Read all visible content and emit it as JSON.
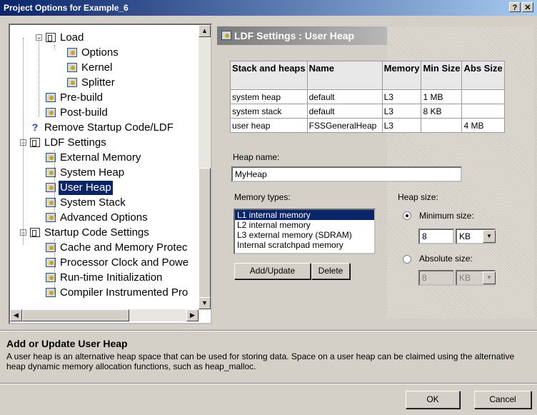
{
  "window": {
    "title": "Project Options for Example_6",
    "help_glyph": "?",
    "close_glyph": "✕"
  },
  "tree": {
    "items": [
      {
        "label": "Load",
        "icon": "folder-icon",
        "expander": "−"
      },
      {
        "label": "Options",
        "icon": "settings-icon"
      },
      {
        "label": "Kernel",
        "icon": "settings-icon"
      },
      {
        "label": "Splitter",
        "icon": "settings-icon"
      },
      {
        "label": "Pre-build",
        "icon": "settings-icon"
      },
      {
        "label": "Post-build",
        "icon": "settings-icon"
      },
      {
        "label": "Remove Startup Code/LDF",
        "icon": "question-icon"
      },
      {
        "label": "LDF Settings",
        "icon": "folder-icon",
        "expander": "−"
      },
      {
        "label": "External Memory",
        "icon": "settings-icon"
      },
      {
        "label": "System Heap",
        "icon": "settings-icon"
      },
      {
        "label": "User Heap",
        "icon": "settings-icon",
        "selected": true
      },
      {
        "label": "System Stack",
        "icon": "settings-icon"
      },
      {
        "label": "Advanced Options",
        "icon": "settings-icon"
      },
      {
        "label": "Startup Code Settings",
        "icon": "folder-icon",
        "expander": "−"
      },
      {
        "label": "Cache and Memory Protec",
        "icon": "settings-icon"
      },
      {
        "label": "Processor Clock and Powe",
        "icon": "settings-icon"
      },
      {
        "label": "Run-time Initialization",
        "icon": "settings-icon"
      },
      {
        "label": "Compiler Instrumented Pro",
        "icon": "settings-icon"
      }
    ],
    "scroll_up": "▲",
    "scroll_down": "▼",
    "scroll_left": "◀",
    "scroll_right": "▶"
  },
  "page": {
    "header": "LDF Settings : User Heap"
  },
  "heap_table": {
    "headers": [
      "Stack and heaps",
      "Name",
      "Memory",
      "Min Size",
      "Abs Size"
    ],
    "rows": [
      [
        "system heap",
        "default",
        "L3",
        "1 MB",
        ""
      ],
      [
        "system stack",
        "default",
        "L3",
        "8 KB",
        ""
      ],
      [
        "user heap",
        "FSSGeneralHeap",
        "L3",
        "",
        "4 MB"
      ]
    ]
  },
  "heap_name": {
    "label": "Heap name:",
    "value": "MyHeap"
  },
  "memory_types": {
    "label": "Memory types:",
    "options": [
      "L1 internal memory",
      "L2 internal memory",
      "L3 external memory (SDRAM)",
      "Internal scratchpad memory"
    ],
    "selected_index": 0
  },
  "buttons": {
    "add_update": "Add/Update",
    "delete": "Delete",
    "ok": "OK",
    "cancel": "Cancel"
  },
  "heap_size": {
    "label": "Heap size:",
    "minimum": {
      "label": "Minimum size:",
      "value": "8",
      "unit": "KB",
      "checked": true
    },
    "absolute": {
      "label": "Absolute size:",
      "value": "8",
      "unit": "KB",
      "checked": false
    },
    "dropdown_glyph": "▼"
  },
  "help": {
    "title": "Add or Update User Heap",
    "text": "A user heap is an alternative heap space that can be used for storing data.  Space on a user heap can be claimed using the alternative heap dynamic memory allocation functions, such as heap_malloc."
  }
}
